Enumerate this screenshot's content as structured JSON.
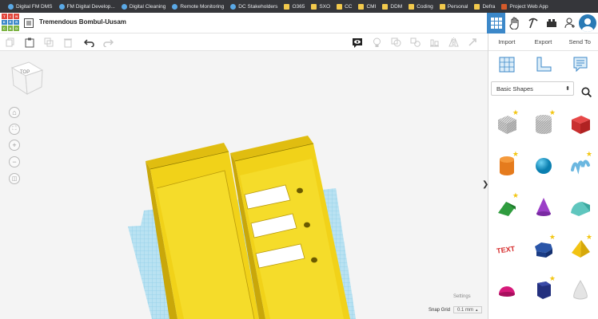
{
  "bookmarks": [
    {
      "label": "Digital FM DMS",
      "icon": "globe-icon"
    },
    {
      "label": "FM Digital Develop...",
      "icon": "globe-icon"
    },
    {
      "label": "Digital Cleaning",
      "icon": "globe-icon"
    },
    {
      "label": "Remote Monitoring",
      "icon": "globe-icon"
    },
    {
      "label": "DC Stakeholders",
      "icon": "globe-icon"
    },
    {
      "label": "O365",
      "icon": "folder-icon"
    },
    {
      "label": "SXO",
      "icon": "folder-icon"
    },
    {
      "label": "CC",
      "icon": "folder-icon"
    },
    {
      "label": "CMI",
      "icon": "folder-icon"
    },
    {
      "label": "DDM",
      "icon": "folder-icon"
    },
    {
      "label": "Coding",
      "icon": "folder-icon"
    },
    {
      "label": "Personal",
      "icon": "folder-icon"
    },
    {
      "label": "Defra",
      "icon": "folder-icon"
    },
    {
      "label": "Project Web App",
      "icon": "project-icon"
    }
  ],
  "logo": [
    "TIN",
    "KER",
    "CAD"
  ],
  "header": {
    "title": "Tremendous Bombul-Uusam"
  },
  "panel": {
    "import_label": "Import",
    "export_label": "Export",
    "sendto_label": "Send To",
    "shape_category": "Basic Shapes"
  },
  "viewcube": {
    "top_label": "TOP"
  },
  "workplane": {
    "settings_label": "Settings",
    "snap_label": "Snap Grid",
    "snap_value": "0.1 mm"
  },
  "shapes": [
    {
      "name": "box-hole",
      "star": true
    },
    {
      "name": "cylinder-hole",
      "star": true
    },
    {
      "name": "box",
      "star": false
    },
    {
      "name": "cylinder",
      "star": true
    },
    {
      "name": "sphere",
      "star": false
    },
    {
      "name": "scribble",
      "star": true
    },
    {
      "name": "roof",
      "star": true
    },
    {
      "name": "cone",
      "star": false
    },
    {
      "name": "round-roof",
      "star": false
    },
    {
      "name": "text",
      "star": false
    },
    {
      "name": "hexagonal-prism",
      "star": true
    },
    {
      "name": "pyramid",
      "star": true
    },
    {
      "name": "half-sphere",
      "star": false
    },
    {
      "name": "polygon",
      "star": true
    },
    {
      "name": "paraboloid",
      "star": false
    }
  ],
  "colors": {
    "accent": "#3c88c9",
    "box_yellow": "#f1d219",
    "grid_blue": "#a9d8ec"
  }
}
